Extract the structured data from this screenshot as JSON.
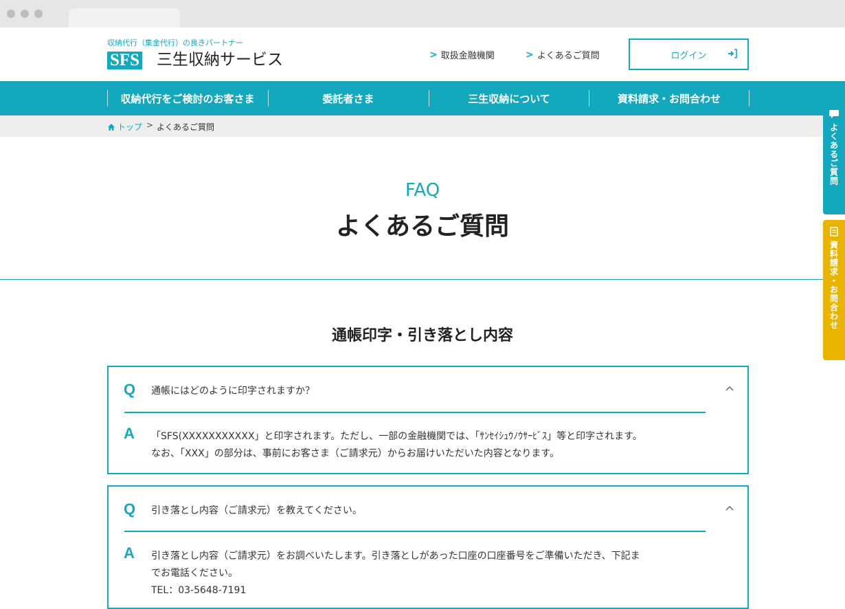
{
  "header": {
    "tagline": "収納代行（集金代行）の良きパートナー",
    "logo_mark": "SFS",
    "logo_name": "三生収納サービス",
    "links": [
      {
        "label": "取扱金融機関"
      },
      {
        "label": "よくあるご質問"
      }
    ],
    "login_label": "ログイン"
  },
  "nav": {
    "items": [
      {
        "label": "収納代行をご検討のお客さま"
      },
      {
        "label": "委託者さま"
      },
      {
        "label": "三生収納について"
      },
      {
        "label": "資料請求・お問合わせ"
      }
    ]
  },
  "breadcrumb": {
    "home": "トップ",
    "separator": ">",
    "current": "よくあるご質問"
  },
  "page": {
    "title_en": "FAQ",
    "title_jp": "よくあるご質問",
    "section_title": "通帳印字・引き落とし内容"
  },
  "faq": [
    {
      "q_mark": "Q",
      "question": "通帳にはどのように印字されますか？",
      "a_mark": "A",
      "answer_lines": [
        "「SFS(XXXXXXXXXXX」と印字されます。ただし、一部の金融機関では、「ｻﾝｾｲｼｭｳﾉｳｻｰﾋﾞｽ」等と印字されます。",
        "なお、「XXX」の部分は、事前にお客さま（ご請求元）からお届けいただいた内容となります。"
      ]
    },
    {
      "q_mark": "Q",
      "question": "引き落とし内容（ご請求元）を教えてください。",
      "a_mark": "A",
      "answer_lines": [
        "引き落とし内容（ご請求元）をお調べいたします。引き落としがあった口座の口座番号をご準備いただき、下記ま",
        "でお電話ください。",
        "TEL：03-5648-7191"
      ]
    }
  ],
  "side_tabs": {
    "faq_label": "よくあるご質問",
    "request_label": "資料請求・お問合わせ"
  },
  "colors": {
    "accent": "#14a8bf",
    "side_request": "#e8b400"
  }
}
